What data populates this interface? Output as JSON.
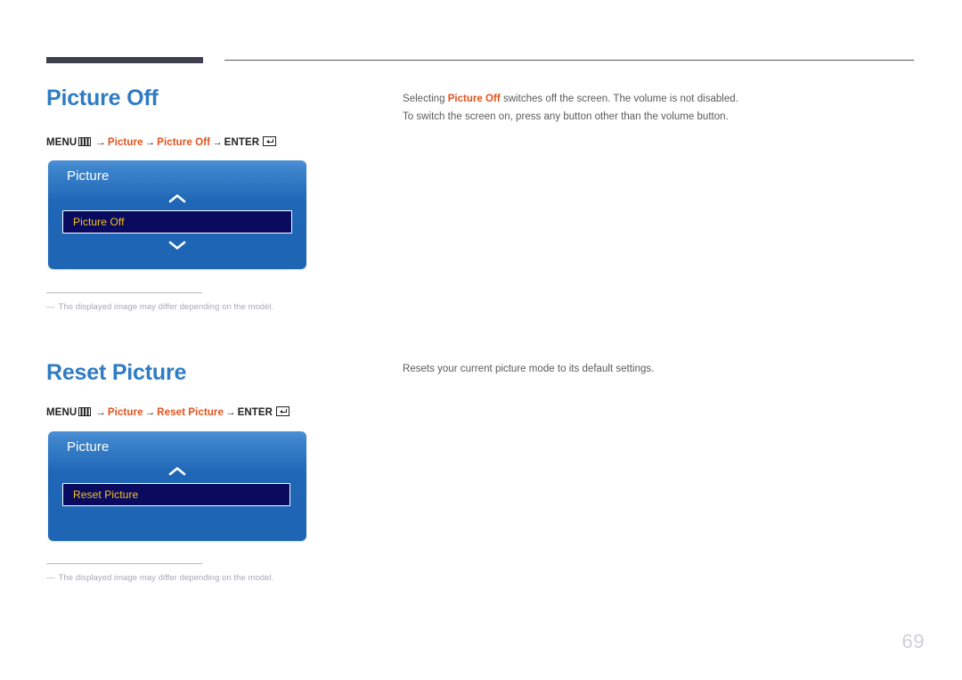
{
  "document": {
    "page_number": "69"
  },
  "icons": {
    "menu": "menu-grid-icon",
    "enter": "enter-return-icon",
    "chevron_up": "chevron-up-icon",
    "chevron_down": "chevron-down-icon"
  },
  "colors": {
    "heading_blue": "#2e7cc4",
    "accent_orange": "#e2521d",
    "panel_blue_top": "#4d90d4",
    "panel_blue_bottom": "#1e66b4",
    "row_navy": "#0a0a5e",
    "row_text_gold": "#f2c521",
    "body_gray": "#5a5a5a",
    "note_gray": "#a9a9b4",
    "rule_dark": "#40404f",
    "page_number_gray": "#cfcfd8"
  },
  "sections": [
    {
      "heading": "Picture Off",
      "path": {
        "menu_label": "MENU",
        "arrow": "→",
        "steps": [
          "Picture",
          "Picture Off"
        ],
        "enter_label": "ENTER"
      },
      "osd": {
        "title": "Picture",
        "selected_item": "Picture Off",
        "has_chevron_up": true,
        "has_chevron_down": true
      },
      "note": {
        "dash": "―",
        "text": "The displayed image may differ depending on the model."
      },
      "body_lines": [
        {
          "parts": [
            {
              "text": "Selecting ",
              "style": "normal"
            },
            {
              "text": "Picture Off",
              "style": "highlight"
            },
            {
              "text": " switches off the screen. The volume is not disabled.",
              "style": "normal"
            }
          ]
        },
        {
          "parts": [
            {
              "text": "To switch the screen on, press any button other than the volume button.",
              "style": "normal"
            }
          ]
        }
      ]
    },
    {
      "heading": "Reset Picture",
      "path": {
        "menu_label": "MENU",
        "arrow": "→",
        "steps": [
          "Picture",
          "Reset Picture"
        ],
        "enter_label": "ENTER"
      },
      "osd": {
        "title": "Picture",
        "selected_item": "Reset Picture",
        "has_chevron_up": true,
        "has_chevron_down": false
      },
      "note": {
        "dash": "―",
        "text": "The displayed image may differ depending on the model."
      },
      "body_lines": [
        {
          "parts": [
            {
              "text": "Resets your current picture mode to its default settings.",
              "style": "normal"
            }
          ]
        }
      ]
    }
  ]
}
